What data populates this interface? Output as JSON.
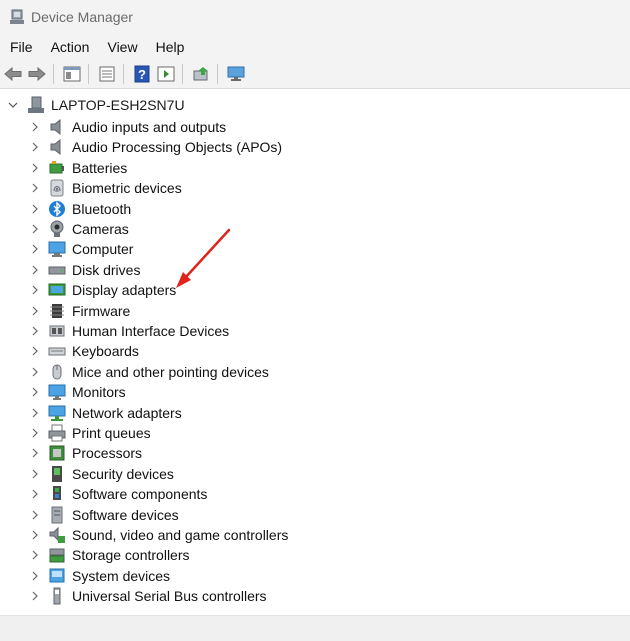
{
  "window": {
    "title": "Device Manager"
  },
  "menu": [
    "File",
    "Action",
    "View",
    "Help"
  ],
  "tree": {
    "root": "LAPTOP-ESH2SN7U",
    "items": [
      {
        "label": "Audio inputs and outputs",
        "icon": "speaker-icon"
      },
      {
        "label": "Audio Processing Objects (APOs)",
        "icon": "speaker-icon"
      },
      {
        "label": "Batteries",
        "icon": "battery-icon"
      },
      {
        "label": "Biometric devices",
        "icon": "fingerprint-icon"
      },
      {
        "label": "Bluetooth",
        "icon": "bluetooth-icon"
      },
      {
        "label": "Cameras",
        "icon": "camera-icon"
      },
      {
        "label": "Computer",
        "icon": "computer-icon"
      },
      {
        "label": "Disk drives",
        "icon": "disk-icon"
      },
      {
        "label": "Display adapters",
        "icon": "display-adapter-icon"
      },
      {
        "label": "Firmware",
        "icon": "firmware-icon"
      },
      {
        "label": "Human Interface Devices",
        "icon": "hid-icon"
      },
      {
        "label": "Keyboards",
        "icon": "keyboard-icon"
      },
      {
        "label": "Mice and other pointing devices",
        "icon": "mouse-icon"
      },
      {
        "label": "Monitors",
        "icon": "monitor-icon"
      },
      {
        "label": "Network adapters",
        "icon": "network-icon"
      },
      {
        "label": "Print queues",
        "icon": "printer-icon"
      },
      {
        "label": "Processors",
        "icon": "processor-icon"
      },
      {
        "label": "Security devices",
        "icon": "security-icon"
      },
      {
        "label": "Software components",
        "icon": "software-component-icon"
      },
      {
        "label": "Software devices",
        "icon": "software-device-icon"
      },
      {
        "label": "Sound, video and game controllers",
        "icon": "sound-icon"
      },
      {
        "label": "Storage controllers",
        "icon": "storage-icon"
      },
      {
        "label": "System devices",
        "icon": "system-icon"
      },
      {
        "label": "Universal Serial Bus controllers",
        "icon": "usb-icon"
      }
    ]
  },
  "colors": {
    "annotation_arrow": "#e0231c",
    "accent_blue": "#1f7fd4"
  }
}
